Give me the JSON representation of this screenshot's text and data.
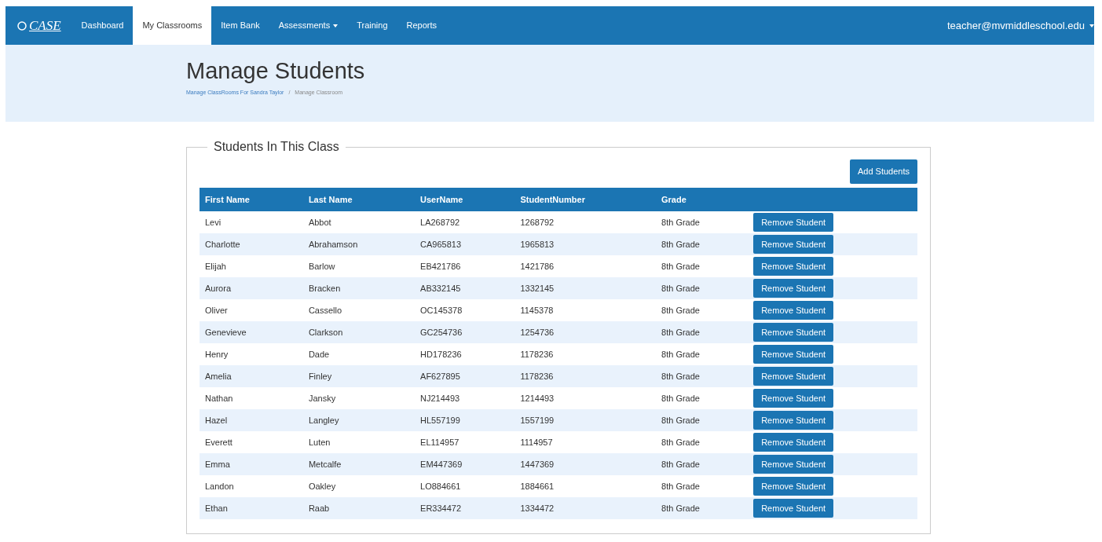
{
  "navbar": {
    "brand": "CASE",
    "items": [
      {
        "label": "Dashboard",
        "selected": false,
        "dropdown": false
      },
      {
        "label": "My Classrooms",
        "selected": true,
        "dropdown": false
      },
      {
        "label": "Item Bank",
        "selected": false,
        "dropdown": false
      },
      {
        "label": "Assessments",
        "selected": false,
        "dropdown": true
      },
      {
        "label": "Training",
        "selected": false,
        "dropdown": false
      },
      {
        "label": "Reports",
        "selected": false,
        "dropdown": false
      }
    ],
    "user": "teacher@mvmiddleschool.edu"
  },
  "header": {
    "title": "Manage Students",
    "separator": "/",
    "breadcrumb": [
      {
        "label": "Manage ClassRooms For Sandra Taylor",
        "link": true
      },
      {
        "label": "Manage Classroom",
        "link": false
      }
    ]
  },
  "section": {
    "legend": "Students In This Class",
    "add_button": "Add Students",
    "table": {
      "columns": [
        "First Name",
        "Last Name",
        "UserName",
        "StudentNumber",
        "Grade"
      ],
      "rows": [
        {
          "cells": [
            "Levi",
            "Abbot",
            "LA268792",
            "1268792",
            "8th Grade"
          ],
          "action": "Remove Student"
        },
        {
          "cells": [
            "Charlotte",
            "Abrahamson",
            "CA965813",
            "1965813",
            "8th Grade"
          ],
          "action": "Remove Student"
        },
        {
          "cells": [
            "Elijah",
            "Barlow",
            "EB421786",
            "1421786",
            "8th Grade"
          ],
          "action": "Remove Student"
        },
        {
          "cells": [
            "Aurora",
            "Bracken",
            "AB332145",
            "1332145",
            "8th Grade"
          ],
          "action": "Remove Student"
        },
        {
          "cells": [
            "Oliver",
            "Cassello",
            "OC145378",
            "1145378",
            "8th Grade"
          ],
          "action": "Remove Student"
        },
        {
          "cells": [
            "Genevieve",
            "Clarkson",
            "GC254736",
            "1254736",
            "8th Grade"
          ],
          "action": "Remove Student"
        },
        {
          "cells": [
            "Henry",
            "Dade",
            "HD178236",
            "1178236",
            "8th Grade"
          ],
          "action": "Remove Student"
        },
        {
          "cells": [
            "Amelia",
            "Finley",
            "AF627895",
            "1178236",
            "8th Grade"
          ],
          "action": "Remove Student"
        },
        {
          "cells": [
            "Nathan",
            "Jansky",
            "NJ214493",
            "1214493",
            "8th Grade"
          ],
          "action": "Remove Student"
        },
        {
          "cells": [
            "Hazel",
            "Langley",
            "HL557199",
            "1557199",
            "8th Grade"
          ],
          "action": "Remove Student"
        },
        {
          "cells": [
            "Everett",
            "Luten",
            "EL114957",
            "1114957",
            "8th Grade"
          ],
          "action": "Remove Student"
        },
        {
          "cells": [
            "Emma",
            "Metcalfe",
            "EM447369",
            "1447369",
            "8th Grade"
          ],
          "action": "Remove Student"
        },
        {
          "cells": [
            "Landon",
            "Oakley",
            "LO884661",
            "1884661",
            "8th Grade"
          ],
          "action": "Remove Student"
        },
        {
          "cells": [
            "Ethan",
            "Raab",
            "ER334472",
            "1334472",
            "8th Grade"
          ],
          "action": "Remove Student"
        }
      ]
    }
  }
}
